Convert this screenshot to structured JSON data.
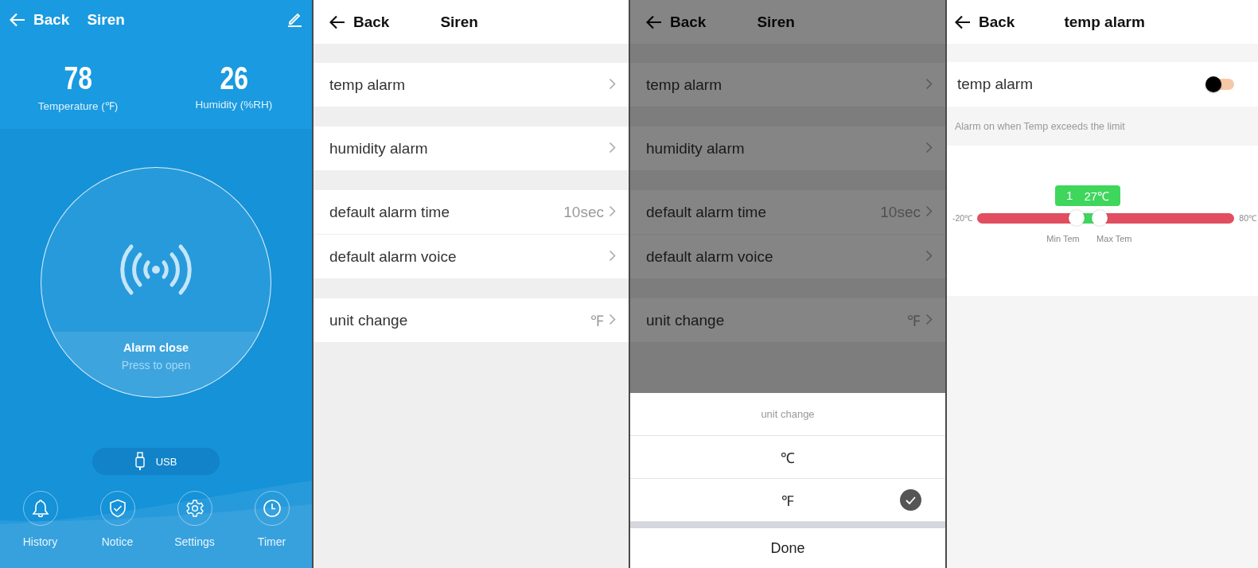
{
  "home": {
    "header": {
      "back": "Back",
      "title": "Siren"
    },
    "stats": [
      {
        "value": "78",
        "label": "Temperature (℉)"
      },
      {
        "value": "26",
        "label": "Humidity (%RH)"
      }
    ],
    "alarm": {
      "status": "Alarm close",
      "hint": "Press to open"
    },
    "power": {
      "label": "USB"
    },
    "nav": [
      {
        "label": "History"
      },
      {
        "label": "Notice"
      },
      {
        "label": "Settings"
      },
      {
        "label": "Timer"
      }
    ]
  },
  "settings": {
    "header": {
      "back": "Back",
      "title": "Siren"
    },
    "groups": [
      [
        {
          "label": "temp alarm"
        }
      ],
      [
        {
          "label": "humidity alarm"
        }
      ],
      [
        {
          "label": "default alarm time",
          "value": "10sec"
        },
        {
          "label": "default alarm voice"
        }
      ],
      [
        {
          "label": "unit change",
          "value": "℉"
        }
      ]
    ]
  },
  "unit_dialog": {
    "header": {
      "back": "Back",
      "title": "Siren"
    },
    "groups": [
      [
        {
          "label": "temp alarm"
        }
      ],
      [
        {
          "label": "humidity alarm"
        }
      ],
      [
        {
          "label": "default alarm time",
          "value": "10sec"
        },
        {
          "label": "default alarm voice"
        }
      ],
      [
        {
          "label": "unit change",
          "value": "℉"
        }
      ]
    ],
    "sheet": {
      "title": "unit change",
      "options": [
        {
          "label": "℃",
          "selected": false
        },
        {
          "label": "℉",
          "selected": true
        }
      ],
      "done": "Done"
    }
  },
  "temp_alarm": {
    "header": {
      "back": "Back",
      "title": "temp alarm"
    },
    "switch": {
      "label": "temp alarm",
      "on": false
    },
    "hint": "Alarm on when Temp exceeds the limit",
    "range": {
      "min_label": "-20℃",
      "max_label": "80℃",
      "bubble": [
        "1",
        "27℃"
      ],
      "thumbs": [
        {
          "label": "Min Tem",
          "level": 0.385
        },
        {
          "label": "Max Tem",
          "level": 0.475
        }
      ]
    }
  }
}
